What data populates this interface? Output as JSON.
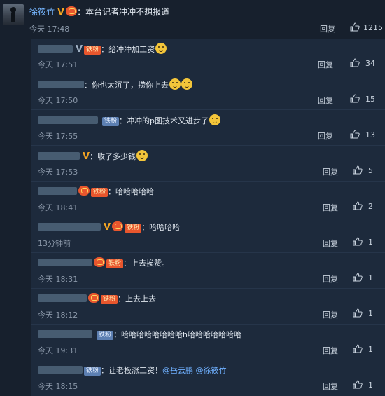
{
  "main_comment": {
    "username": "徐筱竹",
    "verified_mark": "V",
    "text": "：本台记者冲冲不想报道",
    "time": "今天 17:48",
    "reply_label": "回复",
    "likes": "1215"
  },
  "replies": [
    {
      "fan_badge": "铁粉",
      "text": "：给冲冲加工资",
      "time": "今天 17:51",
      "reply_label": "回复",
      "likes": "34"
    },
    {
      "fan_badge": "",
      "text": "：你也太沉了，捞你上去",
      "time": "今天 17:50",
      "reply_label": "回复",
      "likes": "15"
    },
    {
      "fan_badge": "铁粉",
      "text": "：冲冲的p图技术又进步了",
      "time": "今天 17:55",
      "reply_label": "回复",
      "likes": "13"
    },
    {
      "fan_badge": "",
      "verified_mark": "V",
      "text": "：收了多少钱",
      "time": "今天 17:53",
      "reply_label": "回复",
      "likes": "5"
    },
    {
      "fan_badge": "铁粉",
      "text": "：哈哈哈哈哈",
      "time": "今天 18:41",
      "reply_label": "回复",
      "likes": "2"
    },
    {
      "fan_badge": "铁粉",
      "verified_mark": "V",
      "text": "：哈哈哈哈",
      "time": "13分钟前",
      "reply_label": "回复",
      "likes": "1"
    },
    {
      "fan_badge": "铁粉",
      "text": "：上去挨赞。",
      "time": "今天 18:31",
      "reply_label": "回复",
      "likes": "1"
    },
    {
      "fan_badge": "铁粉",
      "text": "：上去上去",
      "time": "今天 18:12",
      "reply_label": "回复",
      "likes": "1"
    },
    {
      "fan_badge": "铁粉",
      "text": "：哈哈哈哈哈哈哈哈h哈哈哈哈哈哈哈",
      "time": "今天 19:31",
      "reply_label": "回复",
      "likes": "1"
    },
    {
      "fan_badge": "铁粉",
      "text": "：让老板涨工资！",
      "mentions": [
        "@岳云鹏",
        "@徐筱竹"
      ],
      "time": "今天 18:15",
      "reply_label": "回复",
      "likes": "1"
    }
  ]
}
